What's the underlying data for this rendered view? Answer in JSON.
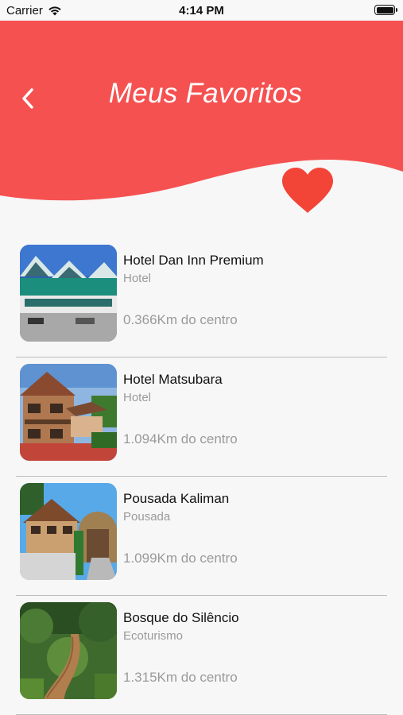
{
  "status_bar": {
    "carrier": "Carrier",
    "time": "4:14 PM",
    "battery_level": 1.0
  },
  "header": {
    "title": "Meus Favoritos",
    "color": "#f65151"
  },
  "heart_color": "#f24437",
  "items": [
    {
      "name": "Hotel Dan Inn Premium",
      "category": "Hotel",
      "distance": "0.366Km do centro"
    },
    {
      "name": "Hotel Matsubara",
      "category": "Hotel",
      "distance": "1.094Km do centro"
    },
    {
      "name": "Pousada Kaliman",
      "category": "Pousada",
      "distance": "1.099Km do centro"
    },
    {
      "name": "Bosque do Silêncio",
      "category": "Ecoturismo",
      "distance": "1.315Km do centro"
    }
  ]
}
